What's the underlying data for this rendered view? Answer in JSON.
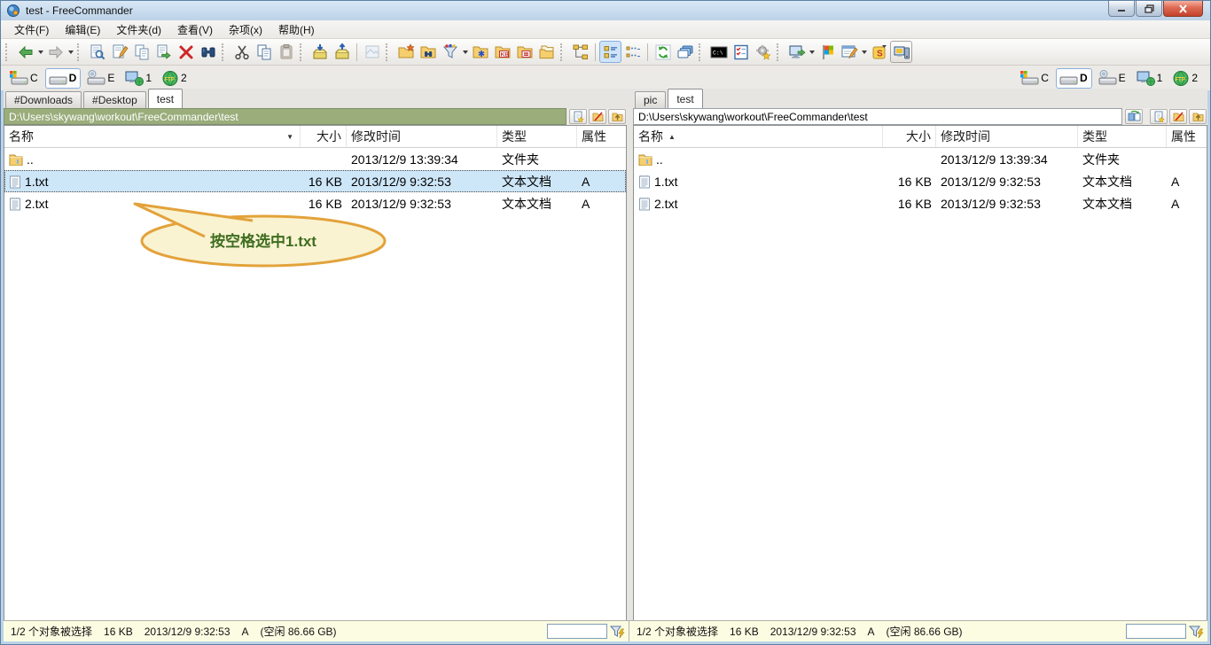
{
  "window": {
    "title": "test - FreeCommander"
  },
  "menu": {
    "items": [
      "文件(F)",
      "编辑(E)",
      "文件夹(d)",
      "查看(V)",
      "杂项(x)",
      "帮助(H)"
    ]
  },
  "toolbar": {
    "icons": [
      "back-icon",
      "back-history-dropdown-icon",
      "forward-icon",
      "forward-history-dropdown-icon",
      "view-file-icon",
      "edit-file-icon",
      "copy-file-icon",
      "move-file-icon",
      "delete-icon",
      "search-icon",
      "cut-icon",
      "copy-icon",
      "paste-icon",
      "pack-icon",
      "unpack-icon",
      "quick-view-icon",
      "new-folder-icon",
      "search-folder-icon",
      "filter-icon",
      "filter-dropdown-icon",
      "folder-favorite-icon",
      "folder-size-icon",
      "folder-compare-icon",
      "copy-folder-icon",
      "tree-view-icon",
      "list-view-icon",
      "details-view-icon",
      "refresh-icon",
      "folder-tabs-icon",
      "command-line-icon",
      "select-files-icon",
      "settings-icon",
      "send-to-screen-icon",
      "startup-icon",
      "editor-icon",
      "scheduler-icon",
      "my-computer-icon"
    ]
  },
  "drives": [
    {
      "label": "C"
    },
    {
      "label": "D",
      "selected": true
    },
    {
      "label": "E"
    },
    {
      "label": "1"
    },
    {
      "label": "2"
    }
  ],
  "left_pane": {
    "tabs": [
      {
        "label": "#Downloads"
      },
      {
        "label": "#Desktop"
      },
      {
        "label": "test",
        "active": true
      }
    ],
    "path": "D:\\Users\\skywang\\workout\\FreeCommander\\test",
    "sort_arrow": "▼",
    "columns": {
      "name": "名称",
      "size": "大小",
      "modified": "修改时间",
      "type": "类型",
      "attr": "属性"
    },
    "rows": [
      {
        "icon": "folder-icon",
        "name": "..",
        "size": "",
        "modified": "2013/12/9 13:39:34",
        "type": "文件夹",
        "attr": ""
      },
      {
        "icon": "text-file-icon",
        "name": "1.txt",
        "size": "16 KB",
        "modified": "2013/12/9 9:32:53",
        "type": "文本文档",
        "attr": "A",
        "selected": true
      },
      {
        "icon": "text-file-icon",
        "name": "2.txt",
        "size": "16 KB",
        "modified": "2013/12/9 9:32:53",
        "type": "文本文档",
        "attr": "A"
      }
    ],
    "status": {
      "selection": "1/2 个对象被选择",
      "size": "16 KB",
      "modified": "2013/12/9 9:32:53",
      "attr": "A",
      "free": "(空闲 86.66 GB)"
    },
    "filter_value": ""
  },
  "right_pane": {
    "tabs": [
      {
        "label": "pic"
      },
      {
        "label": "test",
        "active": true
      }
    ],
    "path": "D:\\Users\\skywang\\workout\\FreeCommander\\test",
    "sort_arrow": "▲",
    "columns": {
      "name": "名称",
      "size": "大小",
      "modified": "修改时间",
      "type": "类型",
      "attr": "属性"
    },
    "rows": [
      {
        "icon": "folder-icon",
        "name": "..",
        "size": "",
        "modified": "2013/12/9 13:39:34",
        "type": "文件夹",
        "attr": ""
      },
      {
        "icon": "text-file-icon",
        "name": "1.txt",
        "size": "16 KB",
        "modified": "2013/12/9 9:32:53",
        "type": "文本文档",
        "attr": "A"
      },
      {
        "icon": "text-file-icon",
        "name": "2.txt",
        "size": "16 KB",
        "modified": "2013/12/9 9:32:53",
        "type": "文本文档",
        "attr": "A"
      }
    ],
    "status": {
      "selection": "1/2 个对象被选择",
      "size": "16 KB",
      "modified": "2013/12/9 9:32:53",
      "attr": "A",
      "free": "(空闲 86.66 GB)"
    },
    "filter_value": ""
  },
  "callout": {
    "text": "按空格选中1.txt"
  },
  "colors": {
    "active_path_bg": "#9aad7b",
    "selection_bg": "#cde6f8",
    "callout_fill": "#f9f3d2",
    "callout_border": "#e3a23a",
    "callout_text": "#3f6d1f",
    "status_bg": "#fcfce2",
    "close_button": "#c3422b"
  }
}
